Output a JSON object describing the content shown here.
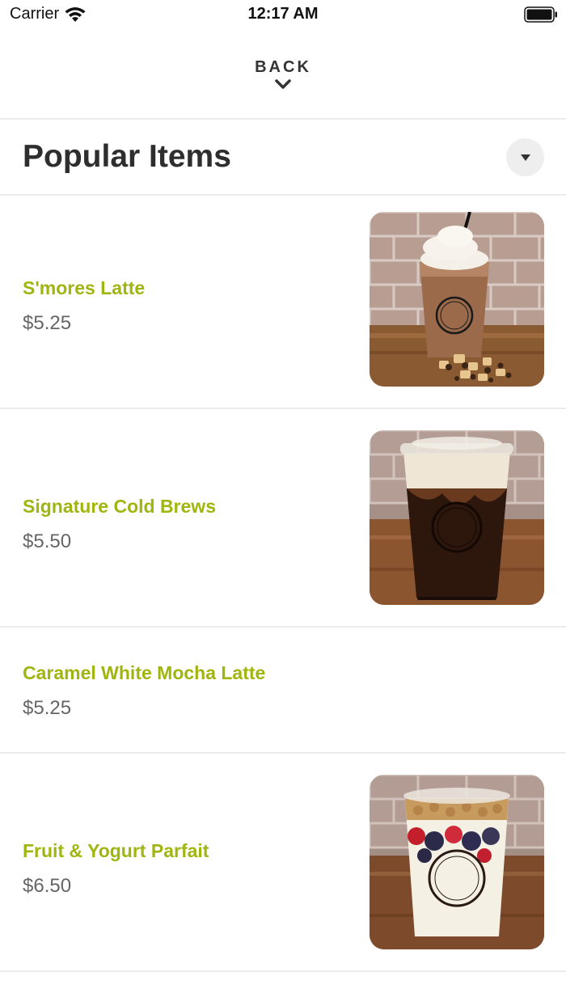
{
  "status_bar": {
    "carrier": "Carrier",
    "time": "12:17 AM",
    "icons": [
      "wifi-icon",
      "battery-icon"
    ]
  },
  "nav": {
    "back_label": "BACK",
    "chevron_icon": "chevron-down-icon"
  },
  "section": {
    "title": "Popular Items",
    "dropdown_icon": "triangle-down-icon"
  },
  "items": [
    {
      "name": "S'mores Latte",
      "price": "$5.25",
      "has_image": true,
      "image_subject": "iced s'mores latte with whipped cream"
    },
    {
      "name": "Signature Cold Brews",
      "price": "$5.50",
      "has_image": true,
      "image_subject": "iced cold brew with cream"
    },
    {
      "name": "Caramel White Mocha Latte",
      "price": "$5.25",
      "has_image": false
    },
    {
      "name": "Fruit & Yogurt Parfait",
      "price": "$6.50",
      "has_image": true,
      "image_subject": "yogurt parfait with berries and granola"
    }
  ],
  "colors": {
    "accent": "#a1b50f",
    "title": "#2e2e2e",
    "price": "#666666",
    "divider": "#ececec"
  }
}
